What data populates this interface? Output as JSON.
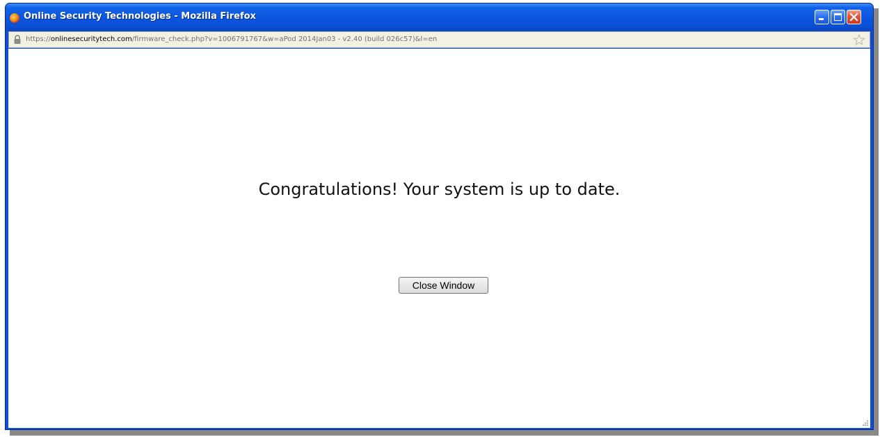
{
  "window": {
    "title": "Online Security Technologies - Mozilla Firefox"
  },
  "address_bar": {
    "scheme": "https://",
    "domain": "onlinesecuritytech.com",
    "path": "/firmware_check.php?v=1006791767&w=aPod 2014Jan03 - v2.40 (build 026c57)&l=en"
  },
  "page": {
    "message": "Congratulations! Your system is up to date.",
    "close_button_label": "Close Window"
  },
  "icons": {
    "app": "firefox-icon",
    "lock": "lock-icon",
    "bookmark": "star-icon",
    "minimize": "minimize-icon",
    "maximize": "maximize-icon",
    "close": "close-icon",
    "resize": "resize-grip-icon"
  },
  "colors": {
    "titlebar": "#0a55dd",
    "close_button": "#e2553a",
    "urlbar_background": "#f3f1e4"
  }
}
